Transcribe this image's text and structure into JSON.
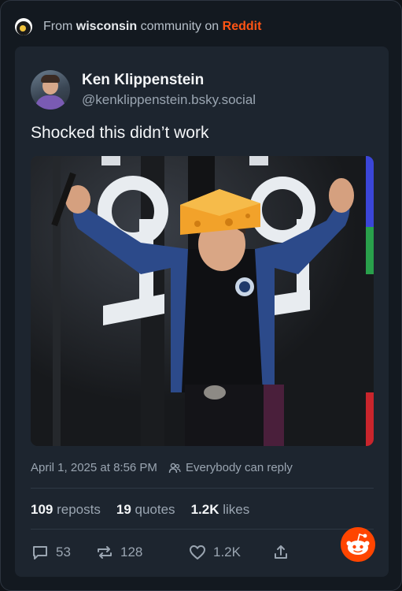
{
  "topbar": {
    "prefix": "From",
    "community": "wisconsin",
    "middle": "community on",
    "platform": "Reddit"
  },
  "post": {
    "author_name": "Ken Klippenstein",
    "author_handle": "@kenklippenstein.bsky.social",
    "text": "Shocked this didn’t work",
    "date": "April 1, 2025 at 8:56 PM",
    "reply_setting": "Everybody can reply"
  },
  "stats": {
    "reposts_count": "109",
    "reposts_label": "reposts",
    "quotes_count": "19",
    "quotes_label": "quotes",
    "likes_count": "1.2K",
    "likes_label": "likes"
  },
  "actions": {
    "replies": "53",
    "reposts": "128",
    "likes": "1.2K"
  },
  "colors": {
    "background": "#131920",
    "card": "#1d252f",
    "reddit_orange": "#ff4500",
    "muted_text": "#9aa5b1"
  },
  "icons": [
    "subreddit-icon",
    "people-icon",
    "reply-icon",
    "repost-icon",
    "heart-icon",
    "share-icon",
    "reddit-snoo-icon"
  ]
}
